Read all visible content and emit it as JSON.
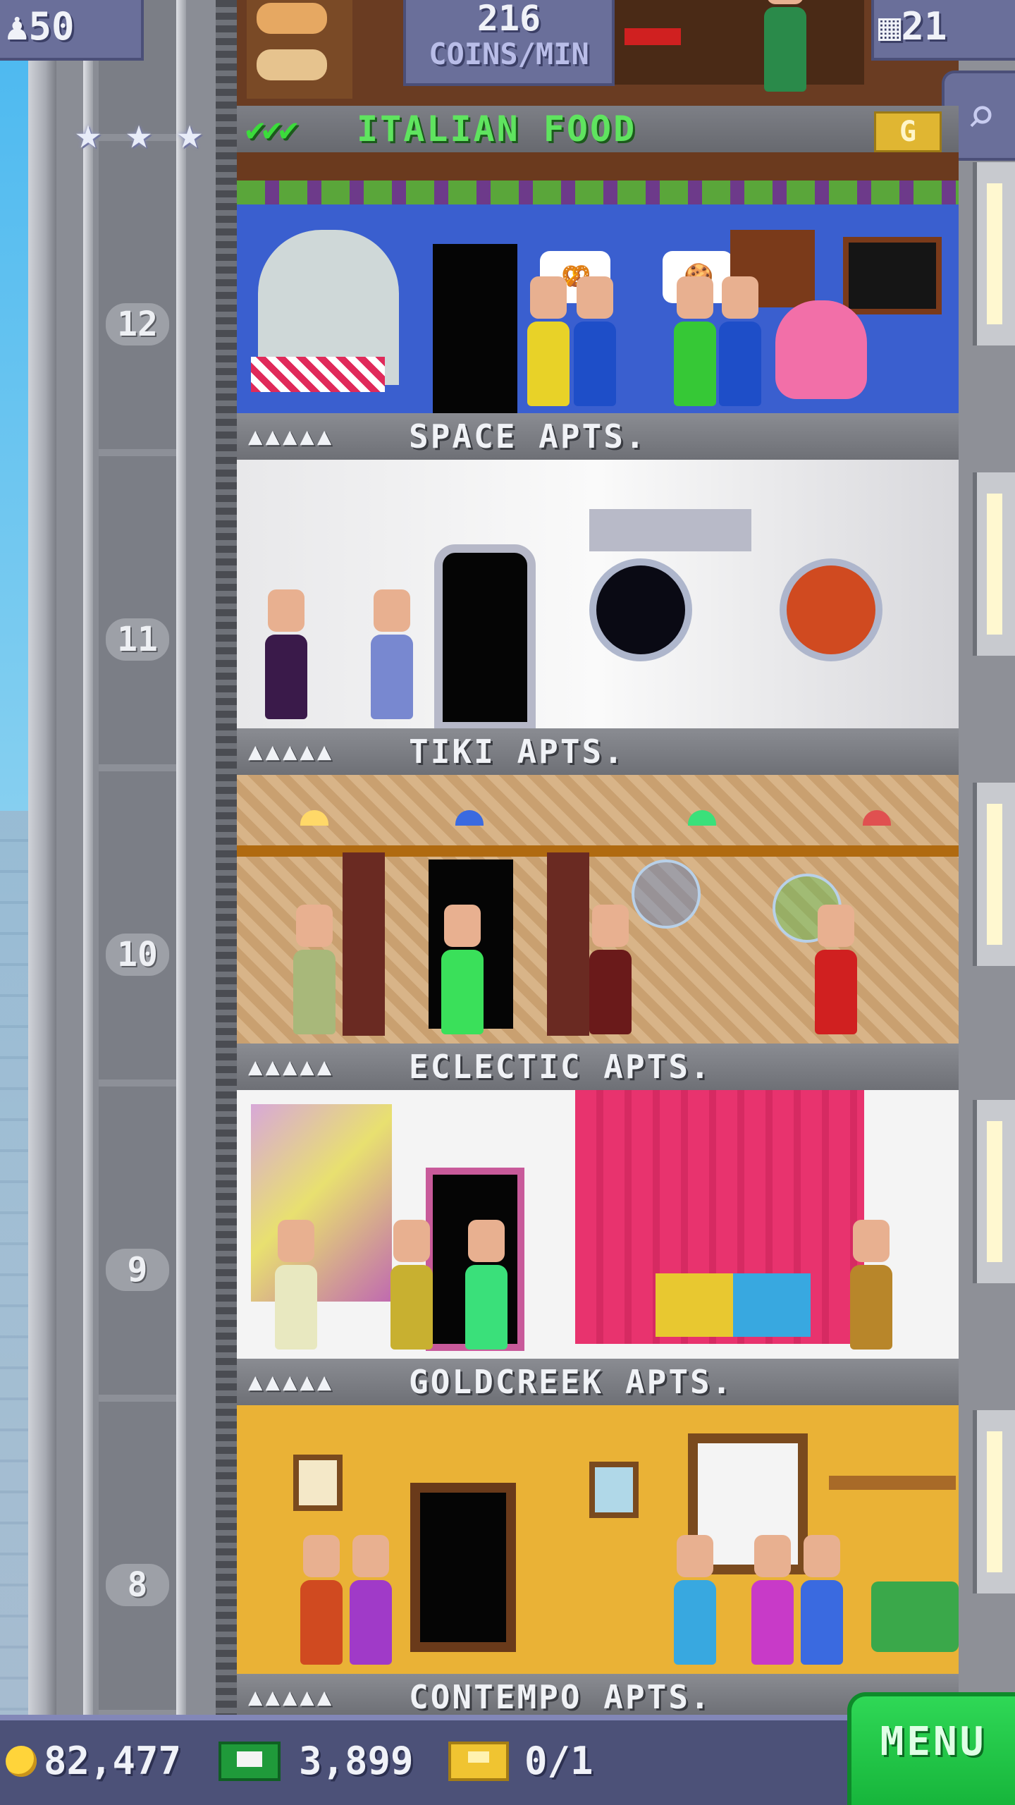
{
  "hud": {
    "population": "50",
    "coins_per_min_value": "216",
    "coins_per_min_label": "COINS/MIN",
    "floor_count": "21",
    "search_icon": "magnifier-icon"
  },
  "top_floor": {
    "name": "ITALIAN FOOD",
    "checks": "✔✔✔",
    "stars": 3,
    "badge": "G",
    "floor_number": "12",
    "bubble_items": [
      "pretzel",
      "cookies"
    ]
  },
  "floors": [
    {
      "name": "SPACE APTS.",
      "floor_number": "11",
      "residents_icon": "▲▲▲▲▲"
    },
    {
      "name": "TIKI APTS.",
      "floor_number": "10",
      "residents_icon": "▲▲▲▲▲"
    },
    {
      "name": "ECLECTIC APTS.",
      "floor_number": "9",
      "residents_icon": "▲▲▲▲▲"
    },
    {
      "name": "GOLDCREEK APTS.",
      "floor_number": "8",
      "residents_icon": "▲▲▲▲▲"
    },
    {
      "name": "CONTEMPO APTS.",
      "floor_number": "",
      "residents_icon": "▲▲▲▲▲"
    }
  ],
  "bottom_bar": {
    "coins": "82,477",
    "bux": "3,899",
    "vip_tickets": "0/1",
    "menu_label": "MENU"
  },
  "colors": {
    "hud_panel": "#6a6f9a",
    "food_label": "#5fe45f",
    "menu_green": "#17b53b",
    "coin_gold": "#ffd43a"
  }
}
